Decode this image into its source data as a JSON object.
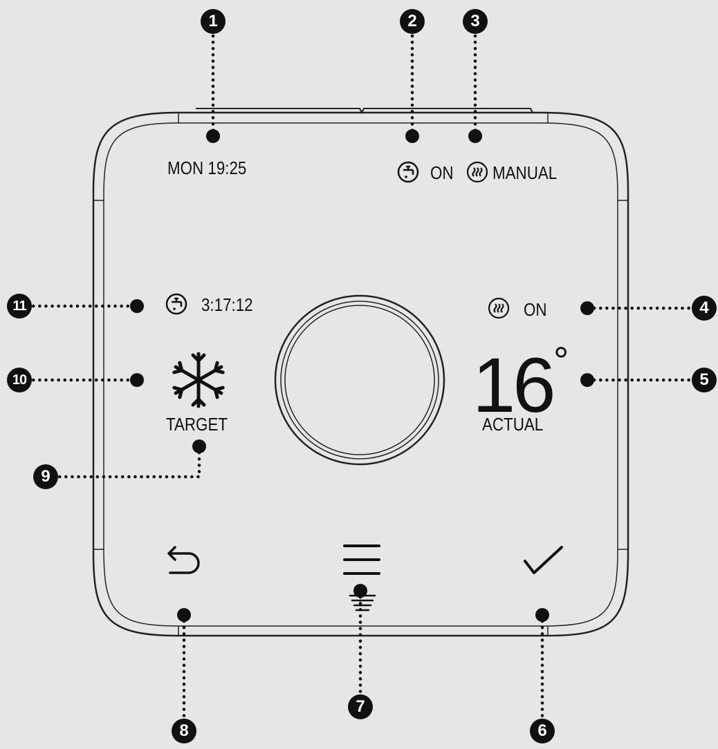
{
  "device": {
    "datetime": "MON 19:25",
    "hot_water_status": "ON",
    "heating_mode": "MANUAL",
    "boost_timer": "3:17:12",
    "heating_status": "ON",
    "actual_temperature": "16",
    "degree_symbol": "°",
    "actual_label": "ACTUAL",
    "target_label": "TARGET",
    "icons": {
      "hot_water": "tap-icon",
      "heating": "radiator-heat-icon",
      "target": "snowflake-icon",
      "back": "back-arrow-icon",
      "menu": "menu-icon",
      "confirm": "checkmark-icon",
      "dial": "rotary-dial"
    }
  },
  "callouts": [
    "1",
    "2",
    "3",
    "4",
    "5",
    "6",
    "7",
    "8",
    "9",
    "10",
    "11"
  ]
}
